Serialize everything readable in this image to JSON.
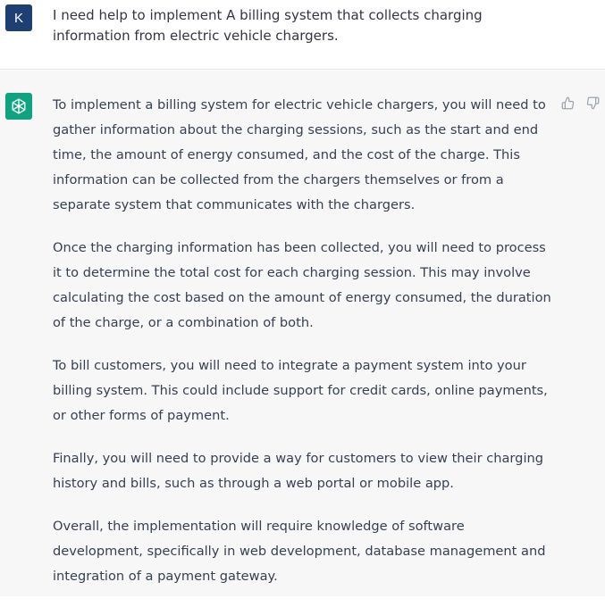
{
  "user": {
    "avatar_letter": "K",
    "message": "I need help to implement A billing system that collects charging information from electric vehicle chargers."
  },
  "assistant": {
    "icon": "openai-logo-icon",
    "paragraphs": [
      "To implement a billing system for electric vehicle chargers, you will need to gather information about the charging sessions, such as the start and end time, the amount of energy consumed, and the cost of the charge. This information can be collected from the chargers themselves or from a separate system that communicates with the chargers.",
      "Once the charging information has been collected, you will need to process it to determine the total cost for each charging session. This may involve calculating the cost based on the amount of energy consumed, the duration of the charge, or a combination of both.",
      "To bill customers, you will need to integrate a payment system into your billing system. This could include support for credit cards, online payments, or other forms of payment.",
      "Finally, you will need to provide a way for customers to view their charging history and bills, such as through a web portal or mobile app.",
      "Overall, the implementation will require knowledge of software development, specifically in web development, database management and integration of a payment gateway."
    ],
    "feedback_icons": [
      "thumbs-up-icon",
      "thumbs-down-icon"
    ]
  },
  "colors": {
    "user_avatar": "#1d3f74",
    "assistant_avatar": "#10a37f",
    "assistant_background": "#f7f7f8"
  }
}
